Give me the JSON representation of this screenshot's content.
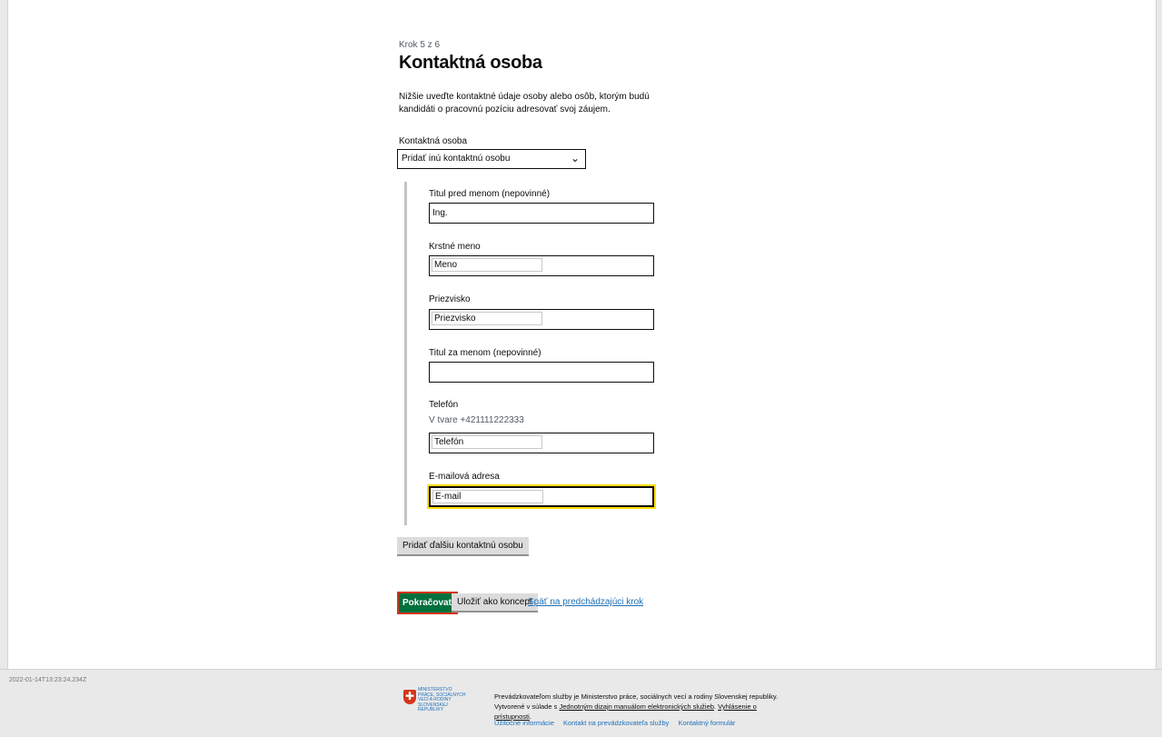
{
  "form": {
    "step_caption": "Krok 5 z 6",
    "title": "Kontaktná osoba",
    "lead": "Nižšie uveďte kontaktné údaje osoby alebo osôb, ktorým budú kandidáti o pracovnú pozíciu adresovať svoj záujem.",
    "contact_select": {
      "label": "Kontaktná osoba",
      "selected": "Pridať inú kontaktnú osobu"
    },
    "fields": {
      "title_before": {
        "label": "Titul pred menom (nepovinné)",
        "value": "Ing."
      },
      "first_name": {
        "label": "Krstné meno",
        "value": "Meno"
      },
      "last_name": {
        "label": "Priezvisko",
        "value": "Priezvisko"
      },
      "title_after": {
        "label": "Titul za menom (nepovinné)",
        "value": ""
      },
      "phone": {
        "label": "Telefón",
        "hint": "V tvare +421111222333",
        "value": "Telefón"
      },
      "email": {
        "label": "E-mailová adresa",
        "value": "E-mail"
      }
    },
    "add_contact_button": "Pridať ďalšiu kontaktnú osobu",
    "actions": {
      "continue": "Pokračovať",
      "save_draft": "Uložiť ako koncept",
      "back": "Späť na predchádzajúci krok"
    }
  },
  "footer": {
    "timestamp": "2022-01-14T13:23:24.234Z",
    "logo_text": "MINISTERSTVO PRÁCE, SOCIÁLNYCH VECÍ A RODINY SLOVENSKEJ REPUBLIKY",
    "operator_text": "Prevádzkovateľom služby je Ministerstvo práce, sociálnych vecí a rodiny Slovenskej republiky. Vytvorené v súlade s",
    "manual_link": "Jednotným dizajn manuálom elektronických služieb",
    "accessibility_link": "Vyhlásenie o prístupnosti",
    "links": [
      "Užitočné informácie",
      "Kontakt na prevádzkovateľa služby",
      "Kontaktný formulár"
    ]
  },
  "colors": {
    "primary_button": "#00703c",
    "focus": "#ffdd00",
    "link": "#1d70b8",
    "error_outline": "#d4351c"
  }
}
